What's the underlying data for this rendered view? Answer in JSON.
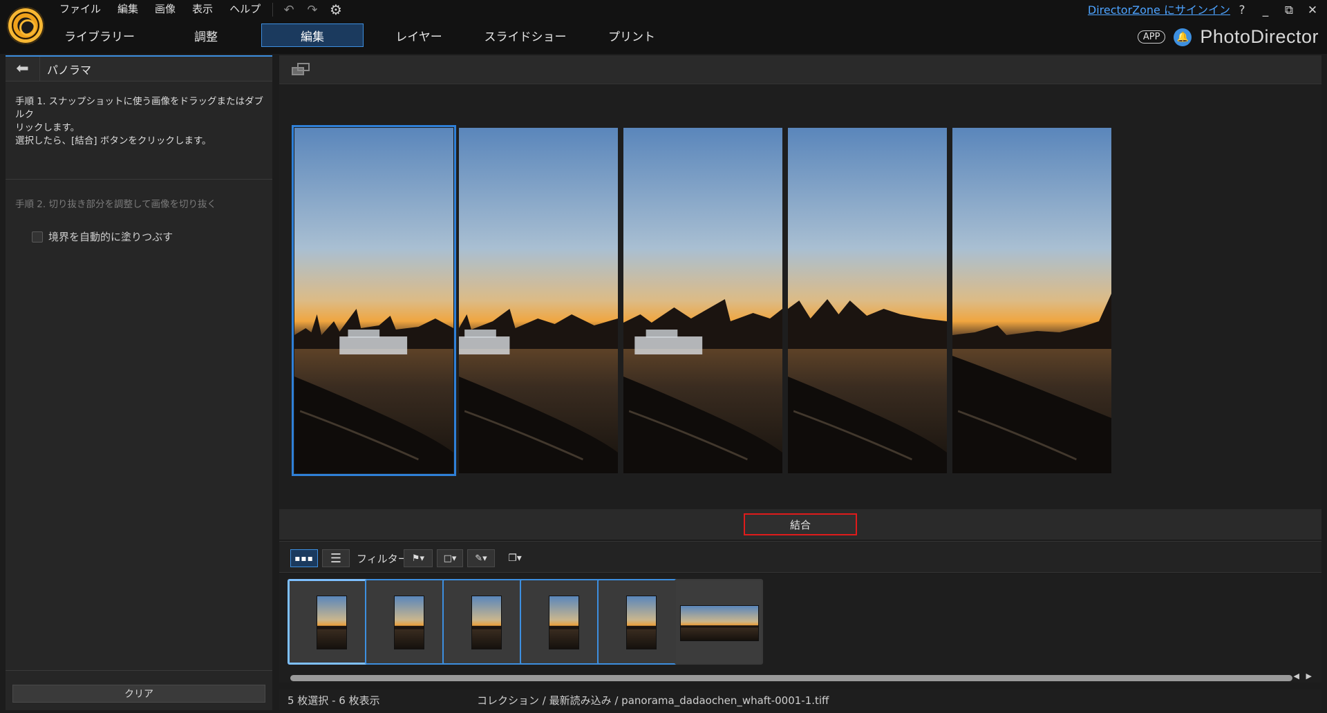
{
  "menu": [
    "ファイル",
    "編集",
    "画像",
    "表示",
    "ヘルプ"
  ],
  "mode_tabs": [
    {
      "label": "ライブラリー",
      "active": false
    },
    {
      "label": "調整",
      "active": false
    },
    {
      "label": "編集",
      "active": true
    },
    {
      "label": "レイヤー",
      "active": false
    },
    {
      "label": "スライドショー",
      "active": false
    },
    {
      "label": "プリント",
      "active": false
    }
  ],
  "header": {
    "signin": "DirectorZone にサインイン",
    "app_badge": "APP",
    "brand": "PhotoDirector",
    "help": "?",
    "minimize": "_",
    "restore": "⧉",
    "close": "✕"
  },
  "left_panel": {
    "title": "パノラマ",
    "step1_line1": "手順 1. スナップショットに使う画像をドラッグまたはダブルク",
    "step1_line2": "リックします。",
    "step1_line3": "選択したら、[結合] ボタンをクリックします。",
    "step2": "手順 2. 切り抜き部分を調整して画像を切り抜く",
    "autofill_label": "境界を自動的に塗りつぶす",
    "clear_button": "クリア"
  },
  "combine_button": "結合",
  "filter": {
    "label": "フィルター:",
    "view_grid": "▪▪▪",
    "view_list": "☰",
    "flag": "⚑▾",
    "color": "□▾",
    "edit": "✎▾",
    "stack": "❐▾"
  },
  "thumbnails": [
    {
      "selected": true
    },
    {
      "selected": true
    },
    {
      "selected": true
    },
    {
      "selected": true
    },
    {
      "selected": true
    },
    {
      "selected": false
    }
  ],
  "scroll": {
    "left": "◀",
    "right": "▶"
  },
  "status": {
    "selection": "5 枚選択 - 6 枚表示",
    "path": "コレクション / 最新読み込み / panorama_dadaochen_whaft-0001-1.tiff"
  },
  "colors": {
    "accent": "#3d8fe0",
    "highlight_red": "#e01b1b"
  }
}
